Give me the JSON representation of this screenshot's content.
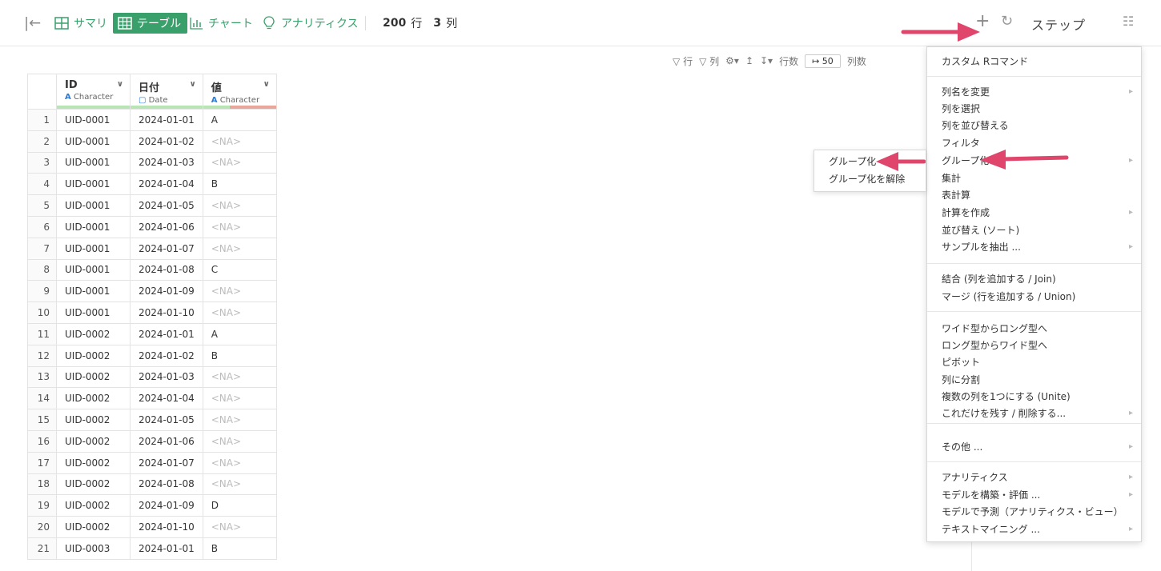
{
  "topbar": {
    "tabs": [
      {
        "label": "サマリ",
        "icon": "summary-grid-icon"
      },
      {
        "label": "テーブル",
        "icon": "table-icon"
      },
      {
        "label": "チャート",
        "icon": "chart-icon"
      },
      {
        "label": "アナリティクス",
        "icon": "bulb-icon"
      }
    ],
    "row_count": "200",
    "row_unit": "行",
    "col_count": "3",
    "col_unit": "列",
    "step_label": "ステップ"
  },
  "toolbar2": {
    "row_filter": "行",
    "col_filter": "列",
    "rows_label": "行数",
    "rows_value": "↦ 50",
    "cols_label": "列数"
  },
  "table": {
    "columns": [
      {
        "name": "ID",
        "type": "Character",
        "type_icon": "A",
        "bar_color": "#b9e4b5"
      },
      {
        "name": "日付",
        "type": "Date",
        "type_icon": "calendar",
        "bar_color": "#b9e4b5"
      },
      {
        "name": "値",
        "type": "Character",
        "type_icon": "A",
        "bar_color": "#e8a79a"
      }
    ],
    "rows": [
      [
        "1",
        "UID-0001",
        "2024-01-01",
        "A"
      ],
      [
        "2",
        "UID-0001",
        "2024-01-02",
        "<NA>"
      ],
      [
        "3",
        "UID-0001",
        "2024-01-03",
        "<NA>"
      ],
      [
        "4",
        "UID-0001",
        "2024-01-04",
        "B"
      ],
      [
        "5",
        "UID-0001",
        "2024-01-05",
        "<NA>"
      ],
      [
        "6",
        "UID-0001",
        "2024-01-06",
        "<NA>"
      ],
      [
        "7",
        "UID-0001",
        "2024-01-07",
        "<NA>"
      ],
      [
        "8",
        "UID-0001",
        "2024-01-08",
        "C"
      ],
      [
        "9",
        "UID-0001",
        "2024-01-09",
        "<NA>"
      ],
      [
        "10",
        "UID-0001",
        "2024-01-10",
        "<NA>"
      ],
      [
        "11",
        "UID-0002",
        "2024-01-01",
        "A"
      ],
      [
        "12",
        "UID-0002",
        "2024-01-02",
        "B"
      ],
      [
        "13",
        "UID-0002",
        "2024-01-03",
        "<NA>"
      ],
      [
        "14",
        "UID-0002",
        "2024-01-04",
        "<NA>"
      ],
      [
        "15",
        "UID-0002",
        "2024-01-05",
        "<NA>"
      ],
      [
        "16",
        "UID-0002",
        "2024-01-06",
        "<NA>"
      ],
      [
        "17",
        "UID-0002",
        "2024-01-07",
        "<NA>"
      ],
      [
        "18",
        "UID-0002",
        "2024-01-08",
        "<NA>"
      ],
      [
        "19",
        "UID-0002",
        "2024-01-09",
        "D"
      ],
      [
        "20",
        "UID-0002",
        "2024-01-10",
        "<NA>"
      ],
      [
        "21",
        "UID-0003",
        "2024-01-01",
        "B"
      ]
    ]
  },
  "menu": {
    "items": [
      {
        "label": "カスタム Rコマンド",
        "sub": false
      },
      {
        "label": "列名を変更",
        "sub": true
      },
      {
        "label": "列を選択",
        "sub": false
      },
      {
        "label": "列を並び替える",
        "sub": false
      },
      {
        "label": "フィルタ",
        "sub": false
      },
      {
        "label": "グループ化",
        "sub": true
      },
      {
        "label": "集計",
        "sub": false
      },
      {
        "label": "表計算",
        "sub": false
      },
      {
        "label": "計算を作成",
        "sub": true
      },
      {
        "label": "並び替え (ソート)",
        "sub": false
      },
      {
        "label": "サンプルを抽出 ...",
        "sub": true
      },
      {
        "label": "結合 (列を追加する / Join)",
        "sub": false
      },
      {
        "label": "マージ (行を追加する / Union)",
        "sub": false
      },
      {
        "label": "ワイド型からロング型へ",
        "sub": false
      },
      {
        "label": "ロング型からワイド型へ",
        "sub": false
      },
      {
        "label": "ピボット",
        "sub": false
      },
      {
        "label": "列に分割",
        "sub": false
      },
      {
        "label": "複数の列を1つにする (Unite)",
        "sub": false
      },
      {
        "label": "これだけを残す / 削除する...",
        "sub": true
      },
      {
        "label": "その他 ...",
        "sub": true
      },
      {
        "label": "アナリティクス",
        "sub": true
      },
      {
        "label": "モデルを構築・評価 ...",
        "sub": true
      },
      {
        "label": "モデルで予測（アナリティクス・ビュー）",
        "sub": false
      },
      {
        "label": "テキストマイニング ...",
        "sub": true
      }
    ]
  },
  "submenu": {
    "items": [
      "グループ化",
      "グループ化を解除"
    ]
  },
  "annotation_color": "#e0456c"
}
